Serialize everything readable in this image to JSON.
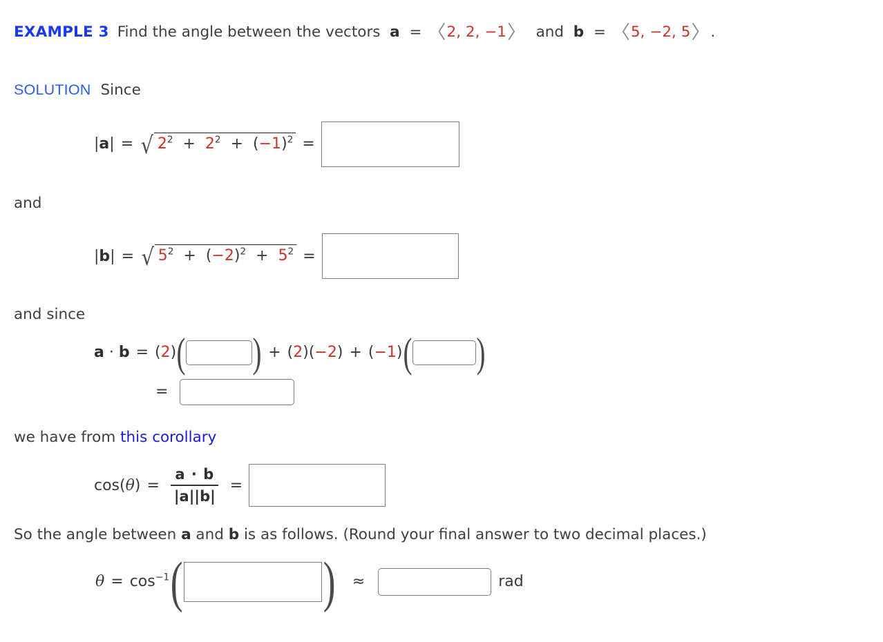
{
  "header": {
    "example_label": "EXAMPLE 3",
    "prompt_pre": "Find the angle between the vectors",
    "vector_a_name": "a",
    "equals": "=",
    "vector_a_components": "2, 2, −1",
    "conjunction": "and",
    "vector_b_name": "b",
    "vector_b_components": "5, −2, 5",
    "period": ".",
    "bracket_open": "〈",
    "bracket_close": "〉"
  },
  "solution": {
    "label": "SOLUTION",
    "intro": "Since"
  },
  "magnitude_a": {
    "lhs_bar_left": "|",
    "lhs_vec": "a",
    "lhs_bar_right": "|",
    "equals": "=",
    "radical": "√",
    "term1_base": "2",
    "term1_exp": "2",
    "plus1": "+",
    "term2_base": "2",
    "term2_exp": "2",
    "plus2": "+",
    "term3_open": "(",
    "term3_base": "−1",
    "term3_close": ")",
    "term3_exp": "2",
    "equals2": "=",
    "answer_value": ""
  },
  "connector_and": "and",
  "magnitude_b": {
    "lhs_bar_left": "|",
    "lhs_vec": "b",
    "lhs_bar_right": "|",
    "equals": "=",
    "radical": "√",
    "term1_base": "5",
    "term1_exp": "2",
    "plus1": "+",
    "term2_open": "(",
    "term2_base": "−2",
    "term2_close": ")",
    "term2_exp": "2",
    "plus2": "+",
    "term3_base": "5",
    "term3_exp": "2",
    "equals2": "=",
    "answer_value": ""
  },
  "connector_and_since": "and since",
  "dot_product": {
    "lhs_a": "a",
    "dot": "·",
    "lhs_b": "b",
    "equals": "=",
    "f1_open": "(",
    "f1_val": "2",
    "f1_close": ")",
    "paren_open": "(",
    "blank1_value": "",
    "paren_close": ")",
    "plus1": "+",
    "f2_open": "(",
    "f2_val": "2",
    "f2_close": ")",
    "f3_open": "(",
    "f3_val": "−2",
    "f3_close": ")",
    "plus2": "+",
    "f4_open": "(",
    "f4_val": "−1",
    "f4_close": ")",
    "paren2_open": "(",
    "blank2_value": "",
    "paren2_close": ")",
    "equals_line2": "=",
    "sum_value": ""
  },
  "corollary_line": {
    "pre": "we have from",
    "link_text": "this corollary"
  },
  "cosine": {
    "fn": "cos(",
    "theta": "θ",
    "fn_close": ")",
    "equals": "=",
    "numerator_a": "a",
    "numerator_dot": "·",
    "numerator_b": "b",
    "denominator": "|a||b|",
    "equals2": "=",
    "answer_value": ""
  },
  "closing_text": {
    "pre": "So the angle between",
    "vec_a": "a",
    "mid": "and",
    "vec_b": "b",
    "post": "is as follows. (Round your final answer to two decimal places.)"
  },
  "final_equation": {
    "theta": "θ",
    "equals": "=",
    "fn": "cos",
    "exponent": "−1",
    "paren_open": "(",
    "blank_value": "",
    "paren_close": ")",
    "approx": "≈",
    "result_value": "",
    "unit": "rad"
  },
  "colors": {
    "link_blue": "#1a1ae0",
    "example_blue": "#1a3af0",
    "solution_blue": "#2b5cf0",
    "number_red": "#cf3126",
    "text_gray": "#3a3a3a",
    "input_border": "#7e7e7e"
  }
}
